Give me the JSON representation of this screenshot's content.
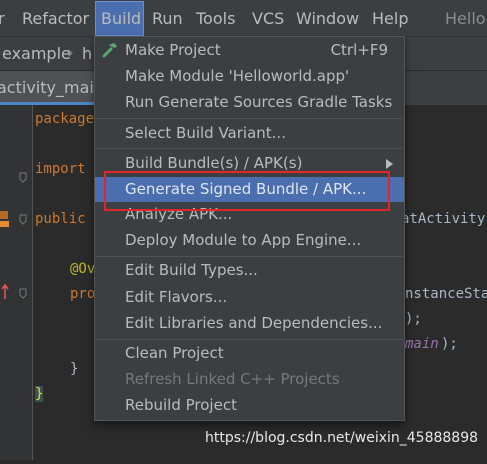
{
  "menubar": {
    "items": [
      "Refactor",
      "Build",
      "Run",
      "Tools",
      "VCS",
      "Window",
      "Help"
    ],
    "partial_left": "r",
    "app_title": "Hello"
  },
  "breadcrumbs": [
    "example",
    "h"
  ],
  "editor_tab": "activity_main.",
  "code": {
    "package_kw": "package",
    "import_kw": "import",
    "public_kw": "public",
    "class_tail": "atActivity",
    "annotation": "@Ov",
    "pro": "pro",
    "instance_tail": "nstanceSta",
    "paren_line": ");",
    "main_field": "main",
    "main_tail": ");",
    "close_brace_1": "}",
    "close_brace_2": "}"
  },
  "build_menu": {
    "items": [
      {
        "label": "Make Project",
        "shortcut": "Ctrl+F9",
        "icon": "hammer-icon"
      },
      {
        "label": "Make Module 'Helloworld.app'"
      },
      {
        "label": "Run Generate Sources Gradle Tasks"
      },
      {
        "label": "Select Build Variant..."
      },
      {
        "label": "Build Bundle(s) / APK(s)",
        "submenu": true
      },
      {
        "label": "Generate Signed Bundle / APK...",
        "selected": true
      },
      {
        "label": "Analyze APK..."
      },
      {
        "label": "Deploy Module to App Engine..."
      },
      {
        "label": "Edit Build Types..."
      },
      {
        "label": "Edit Flavors..."
      },
      {
        "label": "Edit Libraries and Dependencies..."
      },
      {
        "label": "Clean Project"
      },
      {
        "label": "Refresh Linked C++ Projects",
        "disabled": true
      },
      {
        "label": "Rebuild Project"
      }
    ]
  },
  "watermark": "https://blog.csdn.net/weixin_45888898",
  "colors": {
    "selection": "#4b6eaf",
    "highlight_box": "#e0262c",
    "menu_bg": "#3c3f41",
    "editor_bg": "#2b2b2b"
  }
}
